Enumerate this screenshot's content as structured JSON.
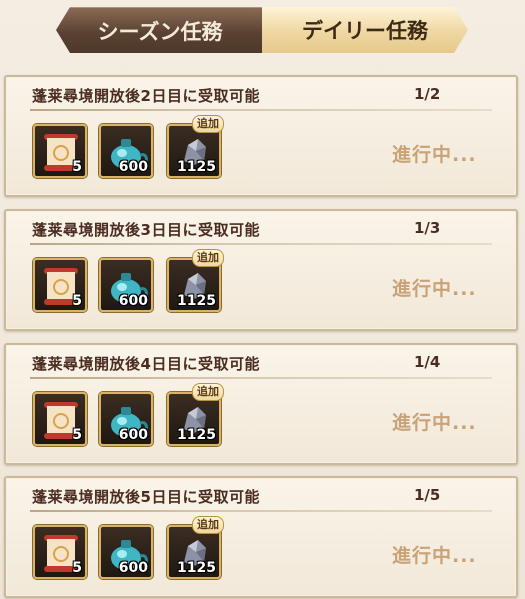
{
  "tabs": [
    {
      "label": "シーズン任務",
      "active": false
    },
    {
      "label": "デイリー任務",
      "active": true
    }
  ],
  "missions": [
    {
      "title": "蓬莱尋境開放後2日目に受取可能",
      "progress": "1/2",
      "status": "進行中...",
      "rewards": [
        {
          "icon": "scroll-icon",
          "count": "5"
        },
        {
          "icon": "potion-pot-icon",
          "count": "600"
        },
        {
          "icon": "ore-icon",
          "count": "1125",
          "badge": "追加"
        }
      ]
    },
    {
      "title": "蓬莱尋境開放後3日目に受取可能",
      "progress": "1/3",
      "status": "進行中...",
      "rewards": [
        {
          "icon": "scroll-icon",
          "count": "5"
        },
        {
          "icon": "potion-pot-icon",
          "count": "600"
        },
        {
          "icon": "ore-icon",
          "count": "1125",
          "badge": "追加"
        }
      ]
    },
    {
      "title": "蓬莱尋境開放後4日目に受取可能",
      "progress": "1/4",
      "status": "進行中...",
      "rewards": [
        {
          "icon": "scroll-icon",
          "count": "5"
        },
        {
          "icon": "potion-pot-icon",
          "count": "600"
        },
        {
          "icon": "ore-icon",
          "count": "1125",
          "badge": "追加"
        }
      ]
    },
    {
      "title": "蓬莱尋境開放後5日目に受取可能",
      "progress": "1/5",
      "status": "進行中...",
      "rewards": [
        {
          "icon": "scroll-icon",
          "count": "5"
        },
        {
          "icon": "potion-pot-icon",
          "count": "600"
        },
        {
          "icon": "ore-icon",
          "count": "1125",
          "badge": "追加"
        }
      ]
    }
  ],
  "colors": {
    "title_text": "#4a2c20",
    "status_text": "#c9a277",
    "reward_frame": "#d8b464",
    "active_tab": "#f0d9a6",
    "inactive_tab": "#5a4232"
  }
}
